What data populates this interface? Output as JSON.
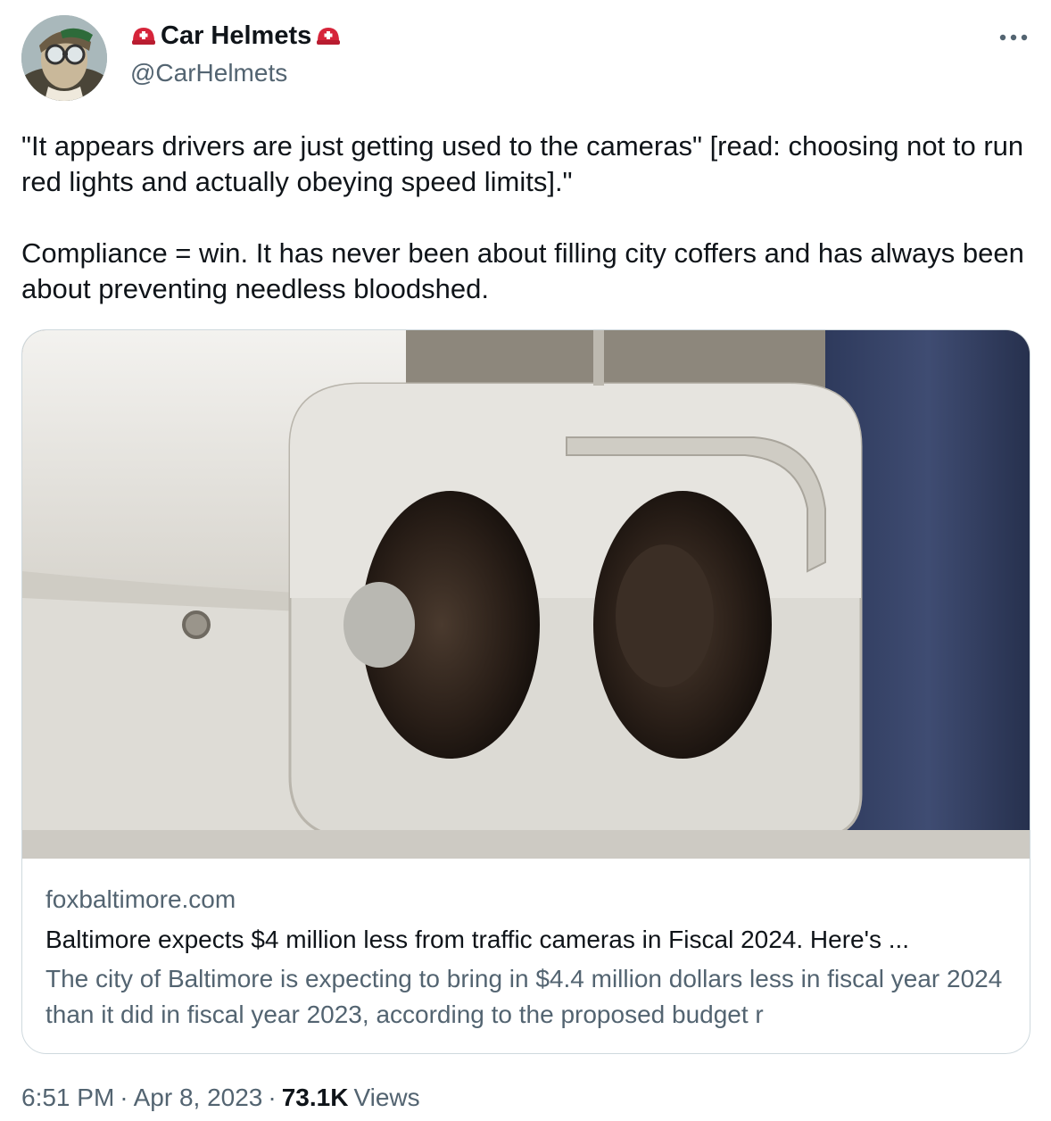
{
  "author": {
    "display_name": "Car Helmets",
    "handle": "@CarHelmets",
    "avatar_icon": "aviator-avatar",
    "name_icons": [
      "helmet-icon",
      "helmet-icon"
    ]
  },
  "tweet": {
    "paragraph_1": "\"It appears drivers are just getting used to the cameras\" [read: choosing not to run red lights and actually obeying speed limits].\"",
    "paragraph_2": "Compliance = win. It has never been about filling city coffers and has always been about preventing needless bloodshed."
  },
  "card": {
    "image_icon": "traffic-camera-photo",
    "domain": "foxbaltimore.com",
    "title": "Baltimore expects $4 million less from traffic cameras in Fiscal 2024. Here's ...",
    "description": "The city of Baltimore is expecting to bring in $4.4 million dollars less in fiscal year 2024 than it did in fiscal year 2023, according to the proposed budget r"
  },
  "footer": {
    "time": "6:51 PM",
    "separator_1": "·",
    "date": "Apr 8, 2023",
    "separator_2": "·",
    "views_count": "73.1K",
    "views_label": "Views"
  },
  "colors": {
    "text_primary": "#0f1419",
    "text_secondary": "#536471",
    "border": "#cfd9de",
    "helmet_red": "#d6243a"
  }
}
